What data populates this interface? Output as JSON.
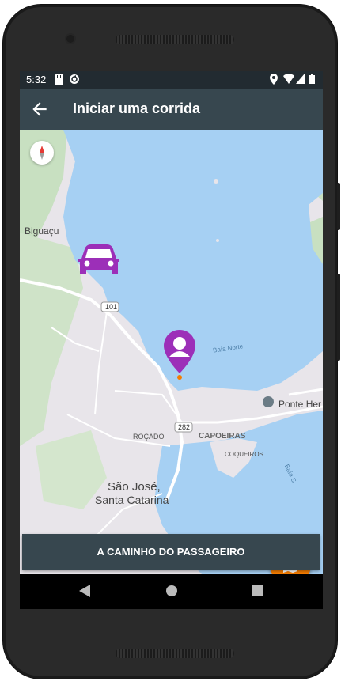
{
  "status_bar": {
    "time": "5:32",
    "icons": [
      "sd-card-icon",
      "sync-icon",
      "location-icon",
      "wifi-icon",
      "signal-icon",
      "battery-icon"
    ]
  },
  "app_bar": {
    "title": "Iniciar uma corrida",
    "back_icon": "arrow-back-icon"
  },
  "map": {
    "labels": {
      "biguacu": "Biguaçu",
      "road_101": "101",
      "baia_norte": "Baía Norte",
      "ponte": "Ponte Her",
      "road_282": "282",
      "rocado": "ROÇADO",
      "capoeiras": "CAPOEIRAS",
      "coqueiros": "COQUEIROS",
      "baia_sul": "Baía S",
      "sao_jose": "São José,",
      "santa_catarina": "Santa Catarina"
    },
    "markers": [
      "car-icon",
      "passenger-pin-icon"
    ]
  },
  "fab": {
    "icon": "map-marker-icon"
  },
  "action_button": {
    "label": "A CAMINHO DO PASSAGEIRO"
  },
  "nav_bar": {
    "buttons": [
      "back-triangle-icon",
      "home-circle-icon",
      "recents-square-icon"
    ]
  },
  "colors": {
    "app_bar": "#37474f",
    "status_bar": "#222b31",
    "water": "#a6d0f3",
    "land": "#e8e5ea",
    "green": "#c8e0c1",
    "marker_purple": "#9c2fb8",
    "fab_orange": "#f57c00"
  }
}
